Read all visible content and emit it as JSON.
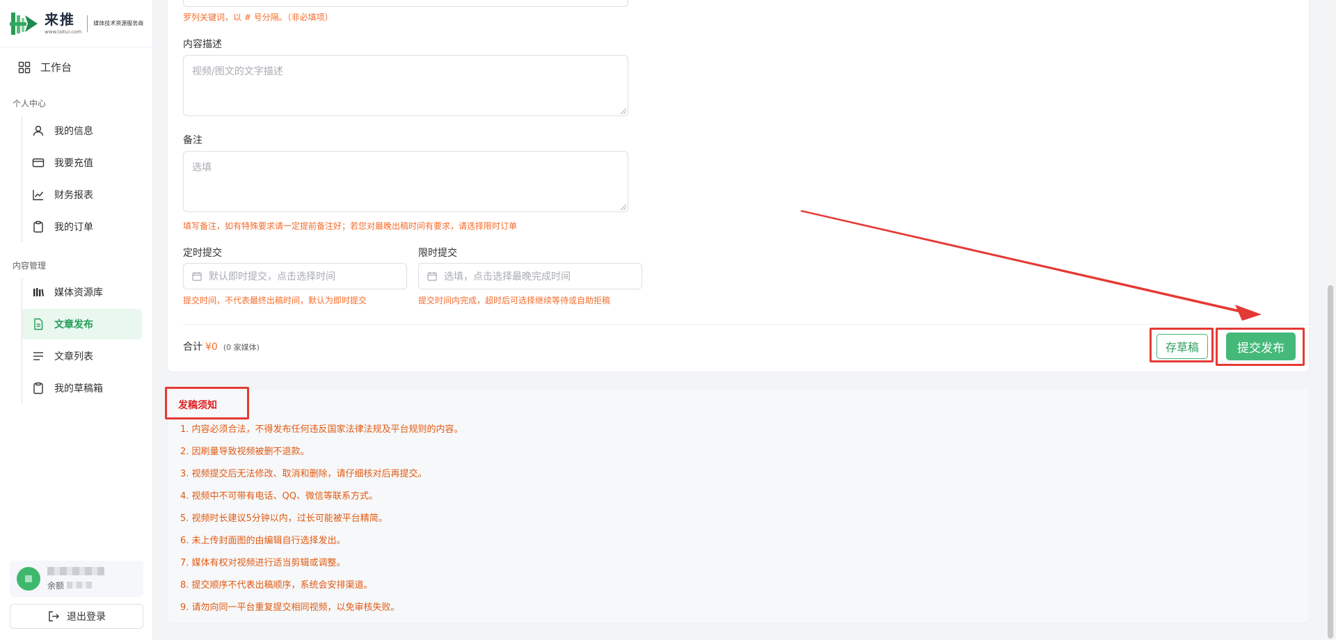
{
  "brand": {
    "name": "来推",
    "url": "www.laitui.com",
    "tagline": "媒体技术资源服务商"
  },
  "sidebar": {
    "workspace_label": "工作台",
    "personal_section": "个人中心",
    "personal_items": [
      {
        "label": "我的信息",
        "icon": "user-icon"
      },
      {
        "label": "我要充值",
        "icon": "credit-card-icon"
      },
      {
        "label": "财务报表",
        "icon": "chart-line-icon"
      },
      {
        "label": "我的订单",
        "icon": "clipboard-icon"
      }
    ],
    "content_section": "内容管理",
    "content_items": [
      {
        "label": "媒体资源库",
        "icon": "library-icon"
      },
      {
        "label": "文章发布",
        "icon": "document-icon",
        "active": true
      },
      {
        "label": "文章列表",
        "icon": "list-icon"
      },
      {
        "label": "我的草稿箱",
        "icon": "draft-icon"
      }
    ],
    "user": {
      "balance_label": "余额"
    },
    "logout_label": "退出登录"
  },
  "form": {
    "keywords_hint": "罗列关键词，以 # 号分隔。（非必填项）",
    "description": {
      "label": "内容描述",
      "placeholder": "视频/图文的文字描述"
    },
    "remark": {
      "label": "备注",
      "placeholder": "选填",
      "hint": "填写备注，如有特殊要求请一定提前备注好；若您对最晚出稿时间有要求，请选择限时订单"
    },
    "scheduled": {
      "label": "定时提交",
      "placeholder": "默认即时提交，点击选择时间",
      "hint": "提交时间，不代表最终出稿时间，默认为即时提交"
    },
    "deadline": {
      "label": "限时提交",
      "placeholder": "选填，点击选择最晚完成时间",
      "hint": "提交时间内完成，超时后可选择继续等待或自助拒稿"
    },
    "total_label": "合计",
    "total_amount": "¥0",
    "total_count": "(0 家媒体)",
    "save_draft_label": "存草稿",
    "submit_label": "提交发布"
  },
  "notice": {
    "title": "发稿须知",
    "items": [
      "1. 内容必须合法，不得发布任何违反国家法律法规及平台规则的内容。",
      "2. 因刷量导致视频被删不退款。",
      "3. 视频提交后无法修改、取消和删除，请仔细核对后再提交。",
      "4. 视频中不可带有电话、QQ、微信等联系方式。",
      "5. 视频时长建议5分钟以内，过长可能被平台精简。",
      "6. 未上传封面图的由编辑自行选择发出。",
      "7. 媒体有权对视频进行适当剪辑或调整。",
      "8. 提交顺序不代表出稿顺序，系统会安排渠道。",
      "9. 请勿向同一平台重复提交相同视频，以免审核失败。"
    ]
  },
  "colors": {
    "accent": "#45b97a",
    "hint": "#f56c2b",
    "annotation": "#e53935"
  }
}
